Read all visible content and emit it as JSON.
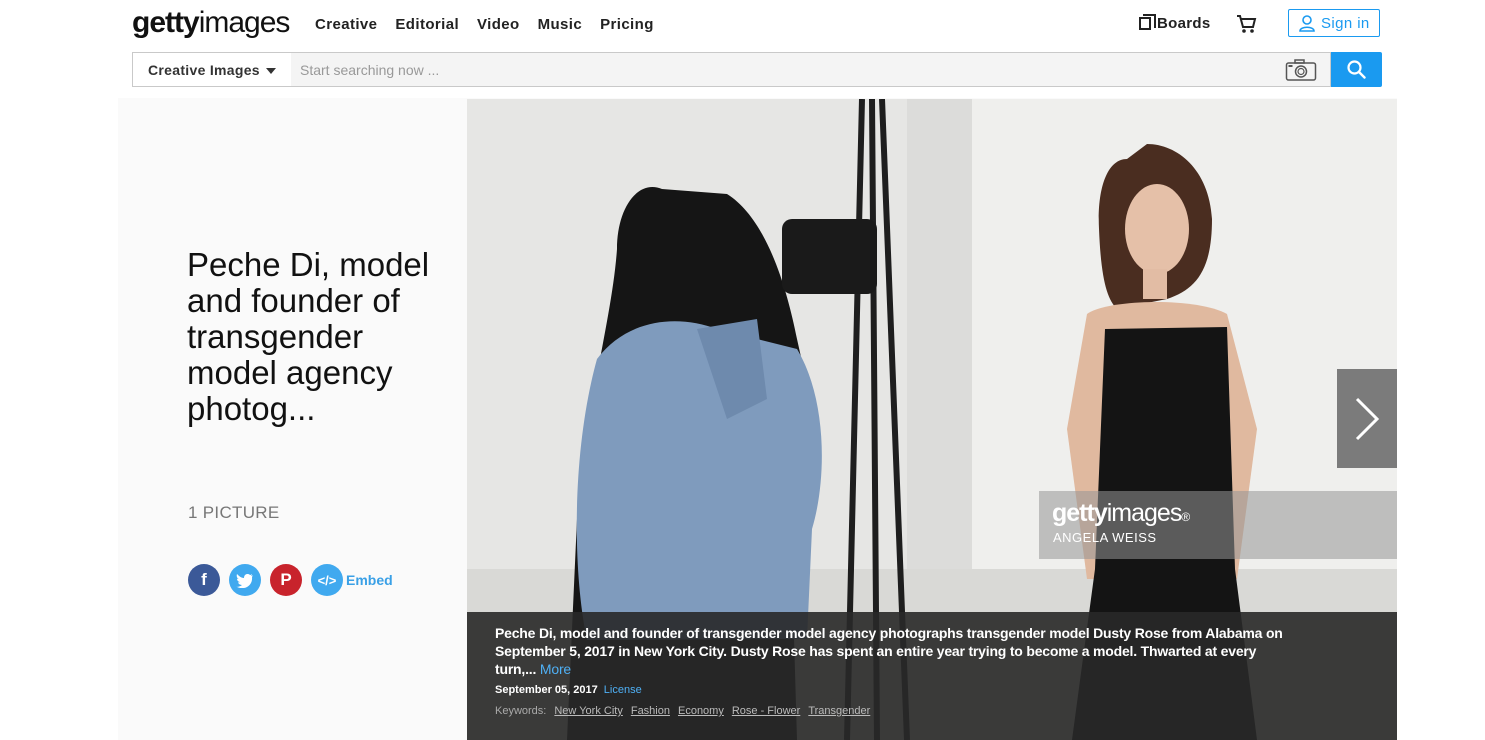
{
  "header": {
    "logo_bold": "getty",
    "logo_light": "images",
    "nav": [
      "Creative",
      "Editorial",
      "Video",
      "Music",
      "Pricing"
    ],
    "boards_label": "Boards",
    "signin_label": "Sign in"
  },
  "search": {
    "dropdown_label": "Creative Images",
    "placeholder": "Start searching now ..."
  },
  "album": {
    "title": "Peche Di, model and founder of transgender model agency photog...",
    "count": "1 PICTURE",
    "embed_label": "Embed"
  },
  "watermark": {
    "logo_bold": "getty",
    "logo_light": "images",
    "mark": "®",
    "credit": "ANGELA WEISS"
  },
  "caption": {
    "text": "Peche Di, model and founder of transgender model agency photographs transgender model Dusty Rose from Alabama on September 5, 2017 in New York City. Dusty Rose has spent an entire year trying to become a model. Thwarted at every turn,...",
    "more_label": "More",
    "date": "September 05, 2017",
    "license_label": "License",
    "keywords_label": "Keywords:",
    "keywords": [
      "New York City",
      "Fashion",
      "Economy",
      "Rose - Flower",
      "Transgender"
    ]
  },
  "colors": {
    "accent": "#1a9af0",
    "facebook": "#3b5998",
    "twitter": "#40a9ef",
    "pinterest": "#c8232c"
  },
  "icons": [
    "boards-icon",
    "cart-icon",
    "user-icon",
    "camera-icon",
    "search-icon",
    "facebook-icon",
    "twitter-icon",
    "pinterest-icon",
    "embed-icon",
    "chevron-right-icon"
  ]
}
